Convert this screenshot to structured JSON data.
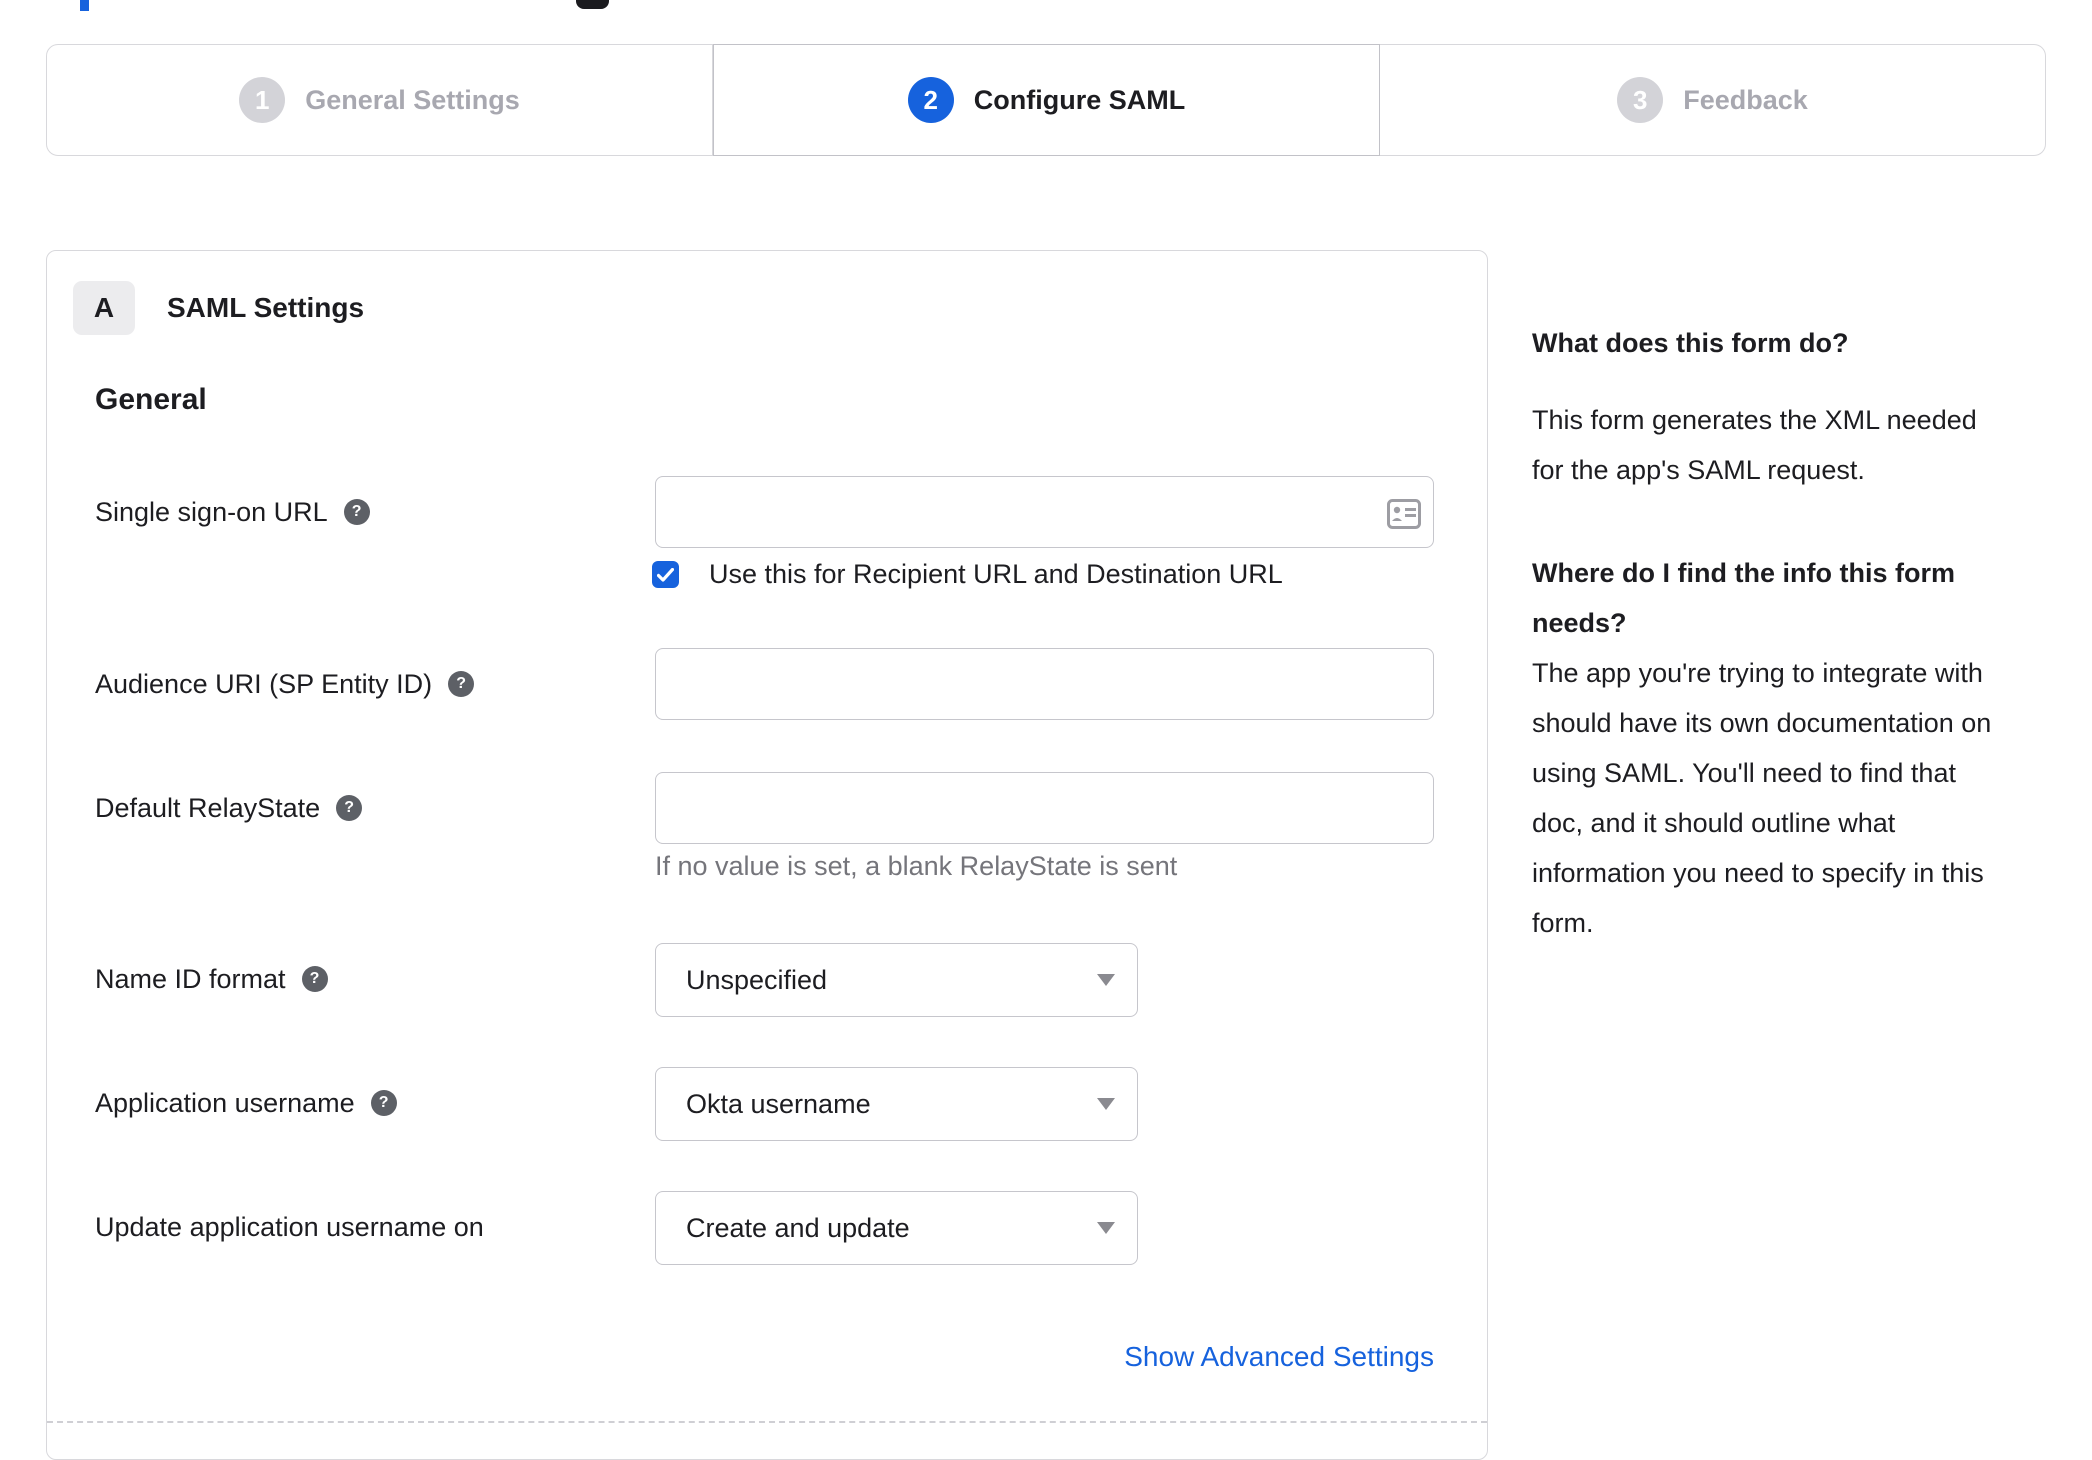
{
  "colors": {
    "accent": "#1662dd",
    "text": "#1d1d21",
    "inactive": "#a8a8b0",
    "border": "#d8d8dc",
    "hint_text": "#75757b"
  },
  "stepper": {
    "steps": [
      {
        "number": "1",
        "label": "General Settings",
        "state": "inactive"
      },
      {
        "number": "2",
        "label": "Configure SAML",
        "state": "active"
      },
      {
        "number": "3",
        "label": "Feedback",
        "state": "inactive"
      }
    ]
  },
  "panel": {
    "section_letter": "A",
    "section_title": "SAML Settings",
    "group_heading": "General",
    "sso": {
      "label": "Single sign-on URL",
      "value": "",
      "checkbox_checked": true,
      "checkbox_label": "Use this for Recipient URL and Destination URL"
    },
    "audience": {
      "label": "Audience URI (SP Entity ID)",
      "value": ""
    },
    "relay_state": {
      "label": "Default RelayState",
      "value": "",
      "hint": "If no value is set, a blank RelayState is sent"
    },
    "name_id_format": {
      "label": "Name ID format",
      "value": "Unspecified"
    },
    "application_username": {
      "label": "Application username",
      "value": "Okta username"
    },
    "update_application_username": {
      "label": "Update application username on",
      "value": "Create and update"
    },
    "advanced_link": "Show Advanced Settings"
  },
  "sidebar": {
    "heading1": "What does this form do?",
    "body1": "This form generates the XML needed\nfor the app's SAML request.",
    "heading2": "Where do I find the info this form\nneeds?",
    "body2": "The app you're trying to integrate with\nshould have its own documentation on\nusing SAML. You'll need to find that\ndoc, and it should outline what\ninformation you need to specify in this\nform."
  },
  "glyphs": {
    "help": "?"
  }
}
